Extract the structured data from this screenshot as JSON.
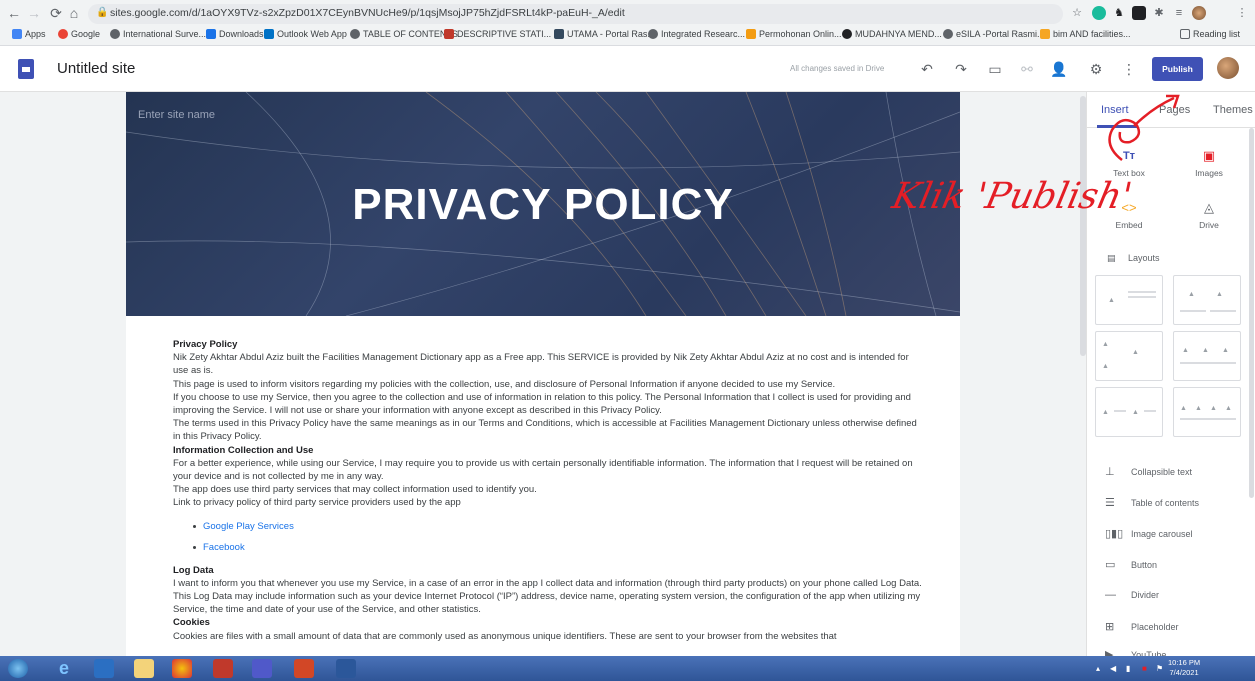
{
  "browser": {
    "url": "sites.google.com/d/1aOYX9TVz-s2xZpzD01X7CEynBVNUcHe9/p/1qsjMsojJP75hZjdFSRLt4kP-paEuH-_A/edit",
    "bookmarks": [
      {
        "label": "Apps",
        "color": "#4285f4"
      },
      {
        "label": "Google",
        "color": "#ea4335"
      },
      {
        "label": "International Surve...",
        "color": "#5f6368"
      },
      {
        "label": "Downloads",
        "color": "#1a73e8"
      },
      {
        "label": "Outlook Web App",
        "color": "#0072c6"
      },
      {
        "label": "TABLE OF CONTENTS",
        "color": "#5f6368"
      },
      {
        "label": "DESCRIPTIVE STATI...",
        "color": "#c0392b"
      },
      {
        "label": "UTAMA - Portal Ras...",
        "color": "#34495e"
      },
      {
        "label": "Integrated Researc...",
        "color": "#5f6368"
      },
      {
        "label": "Permohonan Onlin...",
        "color": "#f39c12"
      },
      {
        "label": "MUDAHNYA MEND...",
        "color": "#202124"
      },
      {
        "label": "eSILA -Portal Rasmi...",
        "color": "#5f6368"
      },
      {
        "label": "bim AND facilities...",
        "color": "#f5a623"
      }
    ],
    "reading_list": "Reading list"
  },
  "app": {
    "title": "Untitled site",
    "saved_status": "All changes saved in Drive",
    "publish_label": "Publish"
  },
  "page": {
    "site_name_placeholder": "Enter site name",
    "banner_title": "PRIVACY POLICY",
    "paragraphs": [
      {
        "type": "heading",
        "text": "Privacy Policy"
      },
      {
        "type": "text",
        "text": "Nik Zety Akhtar Abdul Aziz built the Facilities Management Dictionary app as a Free app. This SERVICE is provided by Nik Zety Akhtar Abdul Aziz at no cost and is intended for use as is."
      },
      {
        "type": "text",
        "text": "This page is used to inform visitors regarding my policies with the collection, use, and disclosure of Personal Information if anyone decided to use my Service."
      },
      {
        "type": "text",
        "text": "If you choose to use my Service, then you agree to the collection and use of information in relation to this policy. The Personal Information that I collect is used for providing and improving the Service. I will not use or share your information with anyone except as described in this Privacy Policy."
      },
      {
        "type": "text",
        "text": "The terms used in this Privacy Policy have the same meanings as in our Terms and Conditions, which is accessible at Facilities Management Dictionary unless otherwise defined in this Privacy Policy."
      },
      {
        "type": "heading",
        "text": "Information Collection and Use"
      },
      {
        "type": "text",
        "text": "For a better experience, while using our Service, I may require you to provide us with certain personally identifiable information. The information that I request will be retained on your device and is not collected by me in any way."
      },
      {
        "type": "text",
        "text": "The app does use third party services that may collect information used to identify you."
      },
      {
        "type": "text",
        "text": "Link to privacy policy of third party service providers used by the app"
      }
    ],
    "links": [
      "Google Play Services",
      "Facebook"
    ],
    "paragraphs2": [
      {
        "type": "heading",
        "text": "Log Data"
      },
      {
        "type": "text",
        "text": "I want to inform you that whenever you use my Service, in a case of an error in the app I collect data and information (through third party products) on your phone called Log Data. This Log Data may include information such as your device Internet Protocol (“IP”) address, device name, operating system version, the configuration of the app when utilizing my Service, the time and date of your use of the Service, and other statistics."
      },
      {
        "type": "heading",
        "text": "Cookies"
      },
      {
        "type": "text",
        "text": "Cookies are files with a small amount of data that are commonly used as anonymous unique identifiers. These are sent to your browser from the websites that"
      }
    ]
  },
  "panel": {
    "tabs": [
      "Insert",
      "Pages",
      "Themes"
    ],
    "insert_items": [
      {
        "label": "Text box",
        "icon": "text-box-icon"
      },
      {
        "label": "Images",
        "icon": "images-icon"
      },
      {
        "label": "Embed",
        "icon": "embed-icon"
      },
      {
        "label": "Drive",
        "icon": "drive-icon"
      }
    ],
    "layouts_label": "Layouts",
    "list_items": [
      {
        "label": "Collapsible text",
        "icon": "collapsible-text-icon"
      },
      {
        "label": "Table of contents",
        "icon": "table-of-contents-icon"
      },
      {
        "label": "Image carousel",
        "icon": "image-carousel-icon"
      },
      {
        "label": "Button",
        "icon": "button-icon"
      },
      {
        "label": "Divider",
        "icon": "divider-icon"
      },
      {
        "label": "Placeholder",
        "icon": "placeholder-icon"
      },
      {
        "label": "YouTube",
        "icon": "youtube-icon"
      }
    ]
  },
  "annotation": {
    "text": "Klik 'Publish'",
    "color": "#e41e26"
  },
  "taskbar": {
    "time": "10:16 PM",
    "date": "7/4/2021"
  },
  "colors": {
    "accent": "#3f51b5",
    "link": "#1a73e8",
    "taskbar": "#2f5597"
  }
}
